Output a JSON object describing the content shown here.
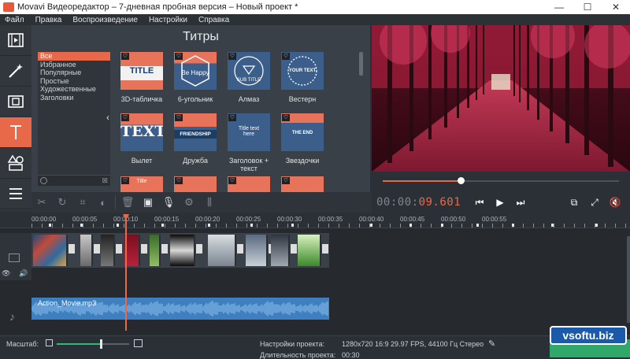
{
  "window": {
    "title": "Movavi Видеоредактор – 7-дневная пробная версия – Новый проект *",
    "controls": {
      "minimize": "—",
      "maximize": "☐",
      "close": "✕"
    }
  },
  "menu": [
    "Файл",
    "Правка",
    "Воспроизведение",
    "Настройки",
    "Справка"
  ],
  "left_tools": [
    {
      "icon": "film-import-icon",
      "active": false
    },
    {
      "icon": "magic-wand-icon",
      "active": false
    },
    {
      "icon": "filters-icon",
      "active": false
    },
    {
      "icon": "titles-icon",
      "active": true
    },
    {
      "icon": "shapes-icon",
      "active": false
    },
    {
      "icon": "more-list-icon",
      "active": false
    }
  ],
  "panel": {
    "title": "Титры",
    "categories": [
      "Все",
      "Избранное",
      "Популярные",
      "Простые",
      "Художественные",
      "Заголовки"
    ],
    "selected_category": "Все",
    "tiles": [
      {
        "label": "3D-табличка",
        "thumb_text": "TITLE"
      },
      {
        "label": "6-угольник",
        "thumb_text": "Be Happy"
      },
      {
        "label": "Алмаз",
        "thumb_text": "SUB TITLE"
      },
      {
        "label": "Вестерн",
        "thumb_text": "YOUR TEXT"
      },
      {
        "label": "Вылет",
        "thumb_text": "TEXT"
      },
      {
        "label": "Дружба",
        "thumb_text": "FRIENDSHIP"
      },
      {
        "label": "Заголовок + текст",
        "thumb_text": "Title text here"
      },
      {
        "label": "Звездочки",
        "thumb_text": "THE END"
      },
      {
        "label": "",
        "thumb_text": "Title"
      }
    ]
  },
  "player": {
    "timecode_prefix": "00:00:",
    "timecode_value": "09.601",
    "progress": 0.33,
    "buttons": [
      "skip-back-icon",
      "play-icon",
      "skip-forward-icon",
      "external-preview-icon",
      "fullscreen-icon",
      "volume-mute-icon"
    ]
  },
  "toolbar": {
    "buttons": [
      "cut-icon",
      "rotate-icon",
      "crop-icon",
      "color-adjust-icon",
      "delete-icon",
      "image-icon",
      "microphone-icon",
      "settings-icon",
      "equalizer-icon"
    ]
  },
  "timeline": {
    "ruler_labels": [
      "00:00:00",
      "00:00:05",
      "00:00:10",
      "00:00:15",
      "00:00:20",
      "00:00:25",
      "00:00:30",
      "00:00:35",
      "00:00:40",
      "00:00:45",
      "00:00:50",
      "00:00:55"
    ],
    "audio_clip": "Action_Movie.mp3"
  },
  "statusbar": {
    "scale_label": "Масштаб:",
    "project_settings_label": "Настройки проекта:",
    "project_settings_value": "1280x720 16:9 29.97 FPS, 44100 Гц Стерео",
    "duration_label": "Длительность проекта:",
    "duration_value": "00:30",
    "zoom_level": 0.6
  },
  "watermark": "vsoftu.biz",
  "colors": {
    "accent": "#e8694a",
    "panel": "#3a4047",
    "audio": "#3e7fc0",
    "export": "#2fa86a"
  }
}
